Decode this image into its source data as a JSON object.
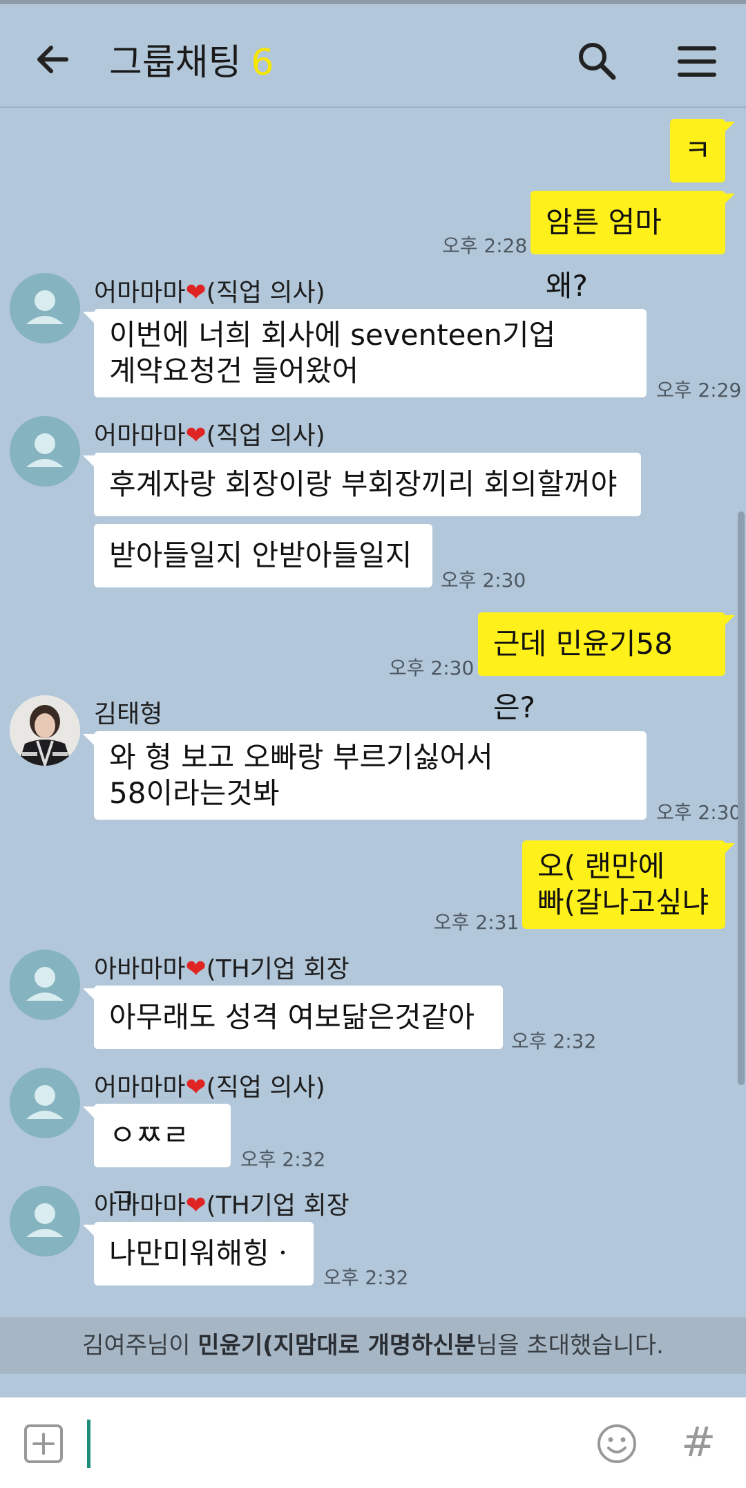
{
  "header": {
    "title": "그룹채팅",
    "member_count": "6",
    "back_icon": "arrow-left-icon",
    "search_icon": "search-icon",
    "menu_icon": "hamburger-menu-icon"
  },
  "messages": [
    {
      "from": "me",
      "text": "ㅋ",
      "time": ""
    },
    {
      "from": "me",
      "text": "암튼 엄마 왜?",
      "time": "오후 2:28"
    },
    {
      "from": "other",
      "sender": "어마마마",
      "sender_suffix": "(직업 의사)",
      "lines": [
        "이번에 너희 회사에 seventeen기업",
        "계약요청건 들어왔어"
      ],
      "time": "오후 2:29"
    },
    {
      "from": "other",
      "sender": "어마마마",
      "sender_suffix": "(직업 의사)",
      "text": "후계자랑 회장이랑 부회장끼리 회의할꺼야",
      "time": ""
    },
    {
      "from": "other",
      "text": "받아들일지 안받아들일지",
      "time": "오후 2:30"
    },
    {
      "from": "me",
      "text": "근데 민윤기58은?",
      "time": "오후 2:30"
    },
    {
      "from": "other",
      "sender": "김태형",
      "lines": [
        "와 형 보고 오빠랑 부르기싫어서",
        "58이라는것봐"
      ],
      "time": "오후 2:30"
    },
    {
      "from": "me",
      "lines": [
        "오( 랜만에",
        "빠(갈나고싶냐"
      ],
      "time": "오후 2:31"
    },
    {
      "from": "other",
      "sender": "아바마마",
      "sender_suffix": "(TH기업 회장",
      "text": "아무래도 성격  여보닮은것같아",
      "time": "오후 2:32"
    },
    {
      "from": "other",
      "sender": "어마마마",
      "sender_suffix": "(직업 의사)",
      "text": "ㅇㅉㄹㄱ",
      "time": "오후 2:32"
    },
    {
      "from": "other",
      "sender": "아바마마",
      "sender_suffix": "(TH기업 회장",
      "text": "나만미워해힝ㆍ",
      "time": "오후 2:32"
    }
  ],
  "heart": "❤",
  "notice": {
    "prefix": "김여주님이 ",
    "bold": "민윤기(지맘대로 개명하신분",
    "suffix": "님을 초대했습니다."
  },
  "input": {
    "plus_icon": "plus-square-icon",
    "emoji_icon": "smiley-icon",
    "hash": "#"
  },
  "colors": {
    "background": "#b2c7d9",
    "my_bubble": "#fef01b",
    "other_bubble": "#ffffff",
    "count": "#f7e600"
  }
}
